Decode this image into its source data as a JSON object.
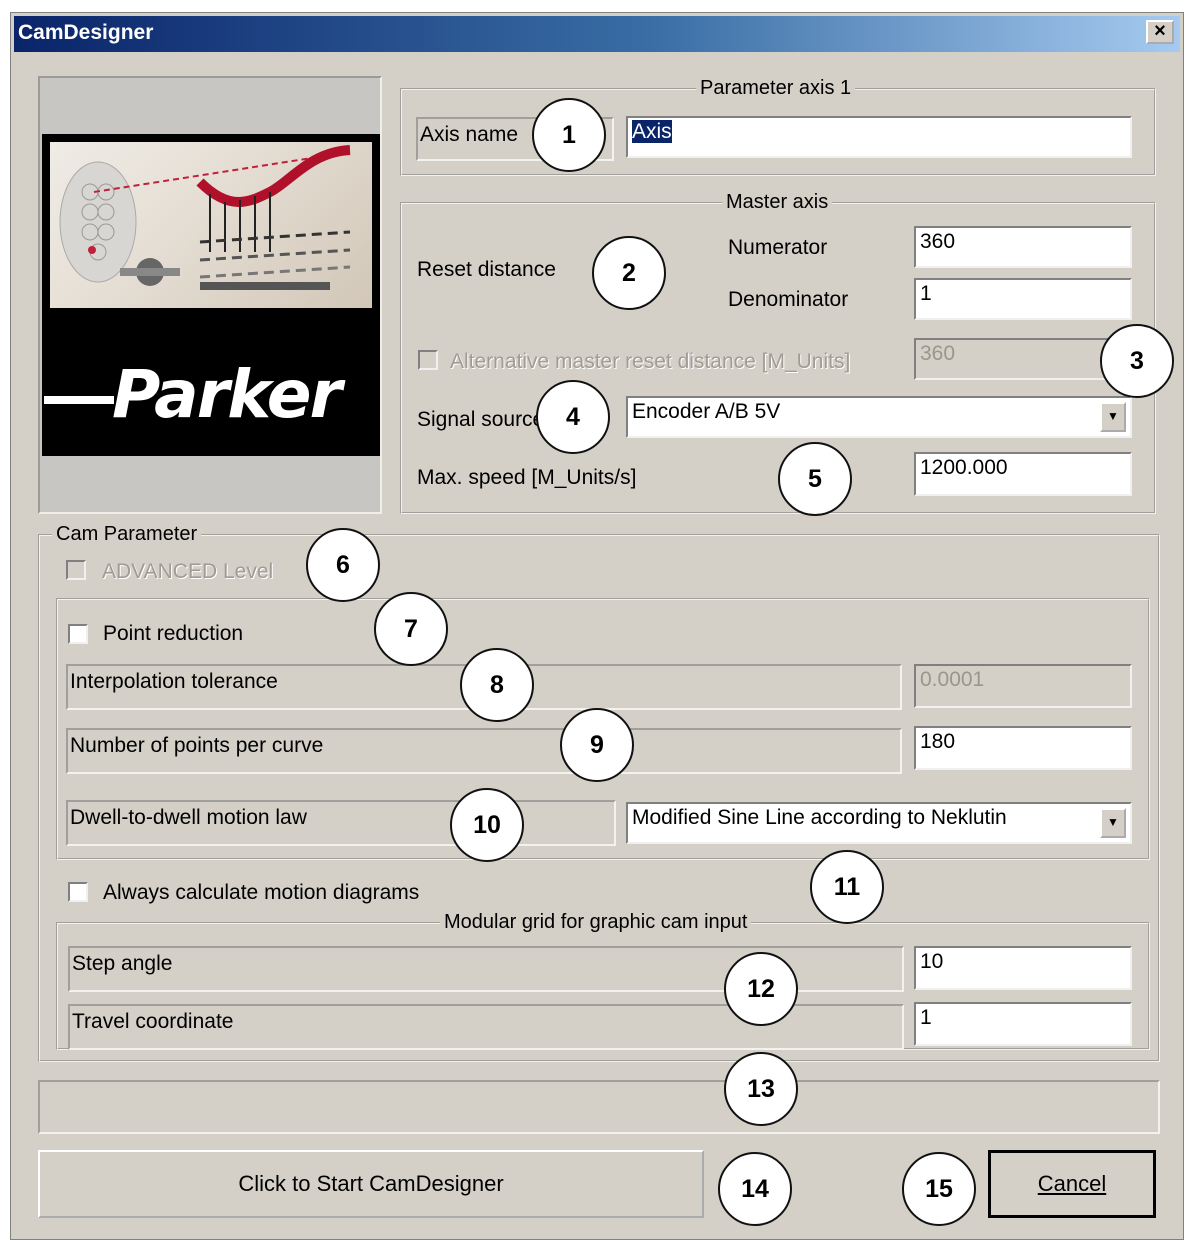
{
  "window": {
    "title": "CamDesigner",
    "close_label": "×"
  },
  "logo": {
    "brand": "Parker"
  },
  "param_axis": {
    "legend": "Parameter axis 1",
    "axis_name_label": "Axis name",
    "axis_name_value": "Axis"
  },
  "master_axis": {
    "legend": "Master axis",
    "reset_distance_label": "Reset distance",
    "numerator_label": "Numerator",
    "numerator_value": "360",
    "denominator_label": "Denominator",
    "denominator_value": "1",
    "alt_reset_label": "Alternative master reset distance [M_Units]",
    "alt_reset_value": "360",
    "signal_source_label": "Signal source",
    "signal_source_value": "Encoder A/B 5V",
    "max_speed_label": "Max. speed [M_Units/s]",
    "max_speed_value": "1200.000"
  },
  "cam_parameter": {
    "legend": "Cam Parameter",
    "advanced_label": "ADVANCED Level",
    "point_reduction_label": "Point reduction",
    "interp_tol_label": "Interpolation tolerance",
    "interp_tol_value": "0.0001",
    "points_per_curve_label": "Number of points per curve",
    "points_per_curve_value": "180",
    "motion_law_label": "Dwell-to-dwell motion law",
    "motion_law_value": "Modified Sine Line according to Neklutin",
    "always_calc_label": "Always calculate motion diagrams"
  },
  "modular_grid": {
    "legend": "Modular grid for graphic cam input",
    "step_angle_label": "Step angle",
    "step_angle_value": "10",
    "travel_coord_label": "Travel coordinate",
    "travel_coord_value": "1"
  },
  "buttons": {
    "start_label": "Click to Start CamDesigner",
    "cancel_label": "Cancel"
  },
  "callouts": [
    "1",
    "2",
    "3",
    "4",
    "5",
    "6",
    "7",
    "8",
    "9",
    "10",
    "11",
    "12",
    "13",
    "14",
    "15"
  ]
}
